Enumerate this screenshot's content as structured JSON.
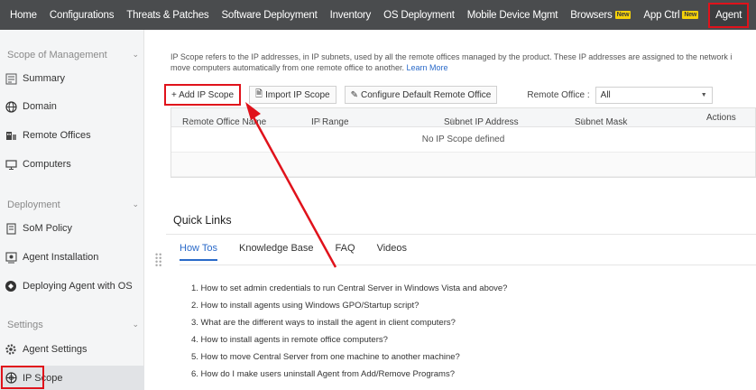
{
  "topnav": {
    "items": [
      "Home",
      "Configurations",
      "Threats & Patches",
      "Software Deployment",
      "Inventory",
      "OS Deployment",
      "Mobile Device Mgmt",
      "Browsers",
      "App Ctrl",
      "Agent"
    ],
    "badge": "New",
    "more": "•••"
  },
  "sidebar": {
    "sections": {
      "scope": "Scope of Management",
      "deployment": "Deployment",
      "settings": "Settings"
    },
    "items": [
      "Summary",
      "Domain",
      "Remote Offices",
      "Computers",
      "SoM Policy",
      "Agent Installation",
      "Deploying Agent with OS",
      "Agent Settings",
      "IP Scope"
    ]
  },
  "content": {
    "description_line1": "IP Scope refers to the IP addresses, in IP subnets, used by all the remote offices managed by the product. These IP addresses are assigned to the network i",
    "description_line2": "move computers automatically from one remote office to another.",
    "learn_more": "Learn More",
    "toolbar": {
      "add": "+ Add IP Scope",
      "import": "Import IP Scope",
      "configure": "Configure Default Remote Office",
      "remote_office_label": "Remote Office :",
      "remote_office_value": "All"
    },
    "table": {
      "columns": [
        "Remote Office Name",
        "IP Range",
        "Subnet IP Address",
        "Subnet Mask",
        "Actions"
      ],
      "empty_message": "No IP Scope defined"
    },
    "quick_links": {
      "title": "Quick Links",
      "tabs": [
        "How Tos",
        "Knowledge Base",
        "FAQ",
        "Videos"
      ],
      "links": [
        "1. How to set admin credentials to run Central Server in Windows Vista and above?",
        "2. How to install agents using Windows GPO/Startup script?",
        "3. What are the different ways to install the agent in client computers?",
        "4. How to install agents in remote office computers?",
        "5. How to move Central Server from one machine to another machine?",
        "6. How do I make users uninstall Agent from Add/Remove Programs?"
      ]
    }
  },
  "colors": {
    "highlight": "#e0121b",
    "link": "#2a6ac9",
    "nav_bg": "#4a4c4e"
  }
}
